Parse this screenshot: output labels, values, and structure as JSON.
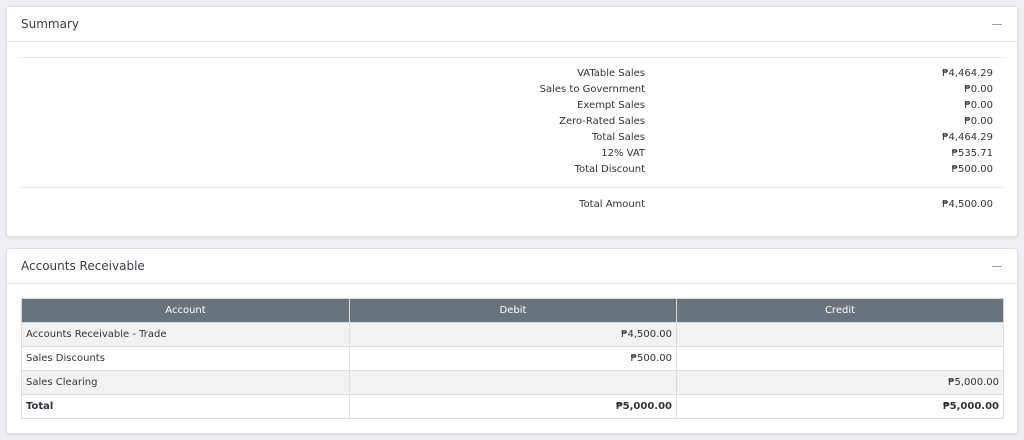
{
  "summary": {
    "title": "Summary",
    "rows": [
      {
        "label": "VATable Sales",
        "value": "₱4,464.29"
      },
      {
        "label": "Sales to Government",
        "value": "₱0.00"
      },
      {
        "label": "Exempt Sales",
        "value": "₱0.00"
      },
      {
        "label": "Zero-Rated Sales",
        "value": "₱0.00"
      },
      {
        "label": "Total Sales",
        "value": "₱4,464.29"
      },
      {
        "label": "12% VAT",
        "value": "₱535.71"
      },
      {
        "label": "Total Discount",
        "value": "₱500.00"
      }
    ],
    "total": {
      "label": "Total Amount",
      "value": "₱4,500.00"
    }
  },
  "accounts_receivable": {
    "title": "Accounts Receivable",
    "columns": [
      "Account",
      "Debit",
      "Credit"
    ],
    "rows": [
      {
        "account": "Accounts Receivable - Trade",
        "debit": "₱4,500.00",
        "credit": ""
      },
      {
        "account": "Sales Discounts",
        "debit": "₱500.00",
        "credit": ""
      },
      {
        "account": "Sales Clearing",
        "debit": "",
        "credit": "₱5,000.00"
      }
    ],
    "total": {
      "account": "Total",
      "debit": "₱5,000.00",
      "credit": "₱5,000.00"
    }
  },
  "icons": {
    "collapse": "minus-icon"
  },
  "colors": {
    "table_header_bg": "#69737c",
    "page_bg": "#eef0f3"
  }
}
